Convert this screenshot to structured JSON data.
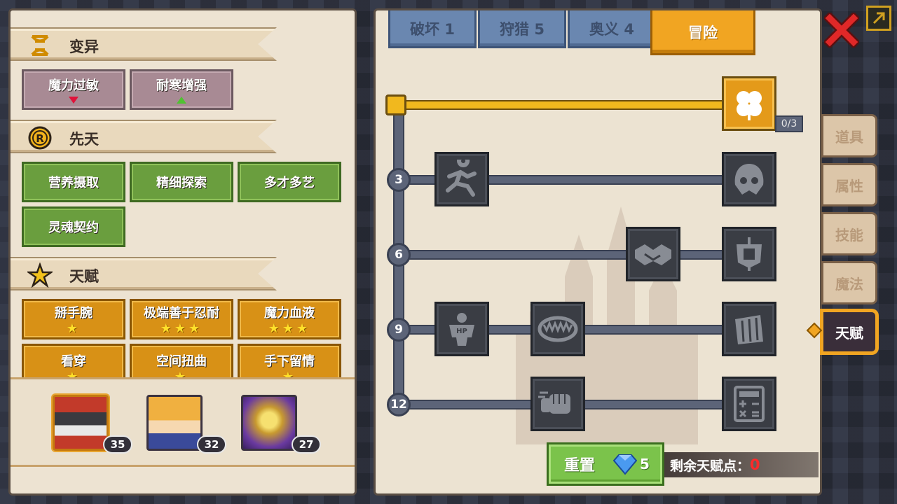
{
  "left": {
    "sections": [
      {
        "title": "变异",
        "icon": "dna-icon"
      },
      {
        "title": "先天",
        "icon": "r-badge-icon"
      },
      {
        "title": "天赋",
        "icon": "star-icon"
      }
    ],
    "mutations": [
      {
        "label": "魔力过敏",
        "trend": "down"
      },
      {
        "label": "耐寒增强",
        "trend": "up"
      }
    ],
    "innate": [
      "营养摄取",
      "精细探索",
      "多才多艺",
      "灵魂契约"
    ],
    "talents": [
      {
        "label": "掰手腕",
        "stars": "★"
      },
      {
        "label": "极端善于忍耐",
        "stars": "★★★"
      },
      {
        "label": "魔力血液",
        "stars": "★★★"
      },
      {
        "label": "看穿",
        "stars": ""
      },
      {
        "label": "空间扭曲",
        "stars": ""
      },
      {
        "label": "手下留情",
        "stars": ""
      }
    ],
    "roster": [
      {
        "level": "35",
        "selected": true
      },
      {
        "level": "32",
        "selected": false
      },
      {
        "level": "27",
        "selected": false
      }
    ]
  },
  "tabs": [
    "破坏 1",
    "狩猎 5",
    "奥义 4",
    "冒险"
  ],
  "tree": {
    "root_progress": "0/3",
    "tiers": [
      "3",
      "6",
      "9",
      "12"
    ]
  },
  "reset": {
    "label": "重置",
    "cost": "5"
  },
  "remaining": {
    "label": "剩余天赋点：",
    "value": "0"
  },
  "side_tabs": [
    "道具",
    "属性",
    "技能",
    "魔法",
    "天赋"
  ],
  "colors": {
    "accent": "#f1a522",
    "active_tab": "#f1a522",
    "inactive_tab": "#6a87b0",
    "remaining_value": "#ff2a2a"
  }
}
